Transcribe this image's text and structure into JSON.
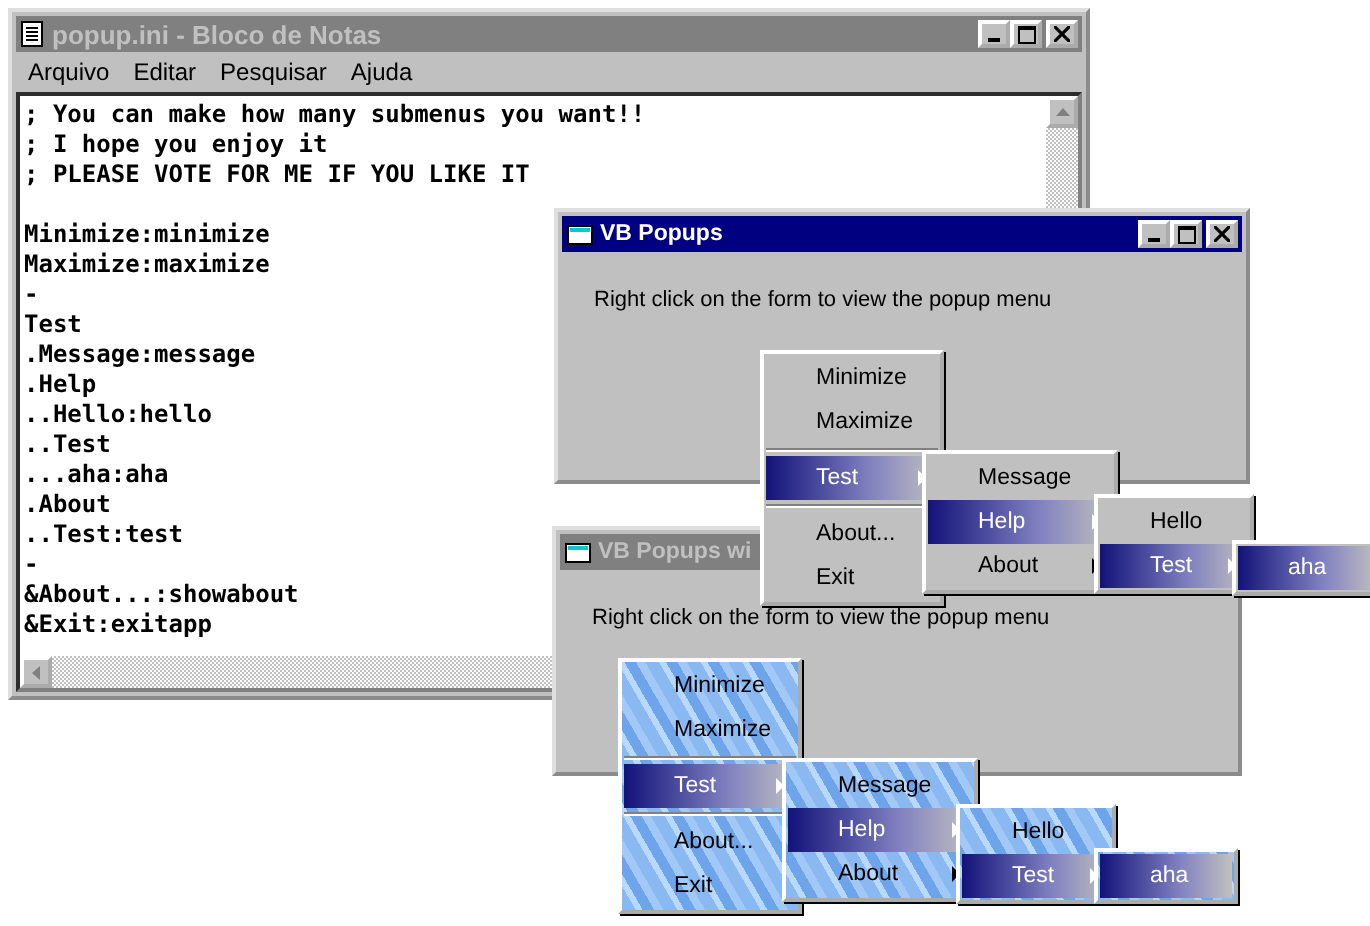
{
  "notepad": {
    "title": "popup.ini - Bloco de Notas",
    "active": false,
    "menu": [
      "Arquivo",
      "Editar",
      "Pesquisar",
      "Ajuda"
    ],
    "blocks": [
      [
        "; You can make how many submenus you want!!",
        "; I hope you enjoy it",
        "; PLEASE VOTE FOR ME IF YOU LIKE IT"
      ],
      [
        "Minimize:minimize",
        "Maximize:maximize",
        "-",
        "Test",
        ".Message:message",
        ".Help",
        "..Hello:hello",
        "..Test",
        "...aha:aha",
        ".About",
        "..Test:test",
        "-",
        "&About...:showabout",
        "&Exit:exitapp"
      ]
    ]
  },
  "windows": [
    {
      "title": "VB Popups",
      "active": true,
      "message": "Right click on the form to view the popup menu",
      "textured_menus": false,
      "menus": [
        [
          {
            "kind": "item",
            "label": "Minimize",
            "submenu": false,
            "selected": false
          },
          {
            "kind": "item",
            "label": "Maximize",
            "submenu": false,
            "selected": false
          },
          {
            "kind": "separator"
          },
          {
            "kind": "item",
            "label": "Test",
            "submenu": true,
            "selected": true
          },
          {
            "kind": "separator"
          },
          {
            "kind": "item",
            "label": "About...",
            "submenu": false,
            "selected": false
          },
          {
            "kind": "item",
            "label": "Exit",
            "submenu": false,
            "selected": false
          }
        ],
        [
          {
            "kind": "item",
            "label": "Message",
            "submenu": false,
            "selected": false
          },
          {
            "kind": "item",
            "label": "Help",
            "submenu": true,
            "selected": true
          },
          {
            "kind": "item",
            "label": "About",
            "submenu": true,
            "selected": false
          }
        ],
        [
          {
            "kind": "item",
            "label": "Hello",
            "submenu": false,
            "selected": false
          },
          {
            "kind": "item",
            "label": "Test",
            "submenu": true,
            "selected": true
          }
        ],
        [
          {
            "kind": "item",
            "label": "aha",
            "submenu": false,
            "selected": true
          }
        ]
      ]
    },
    {
      "title": "VB Popups wi",
      "active": false,
      "message": "Right click on the form to view the popup menu",
      "textured_menus": true,
      "menus": [
        [
          {
            "kind": "item",
            "label": "Minimize",
            "submenu": false,
            "selected": false
          },
          {
            "kind": "item",
            "label": "Maximize",
            "submenu": false,
            "selected": false
          },
          {
            "kind": "separator"
          },
          {
            "kind": "item",
            "label": "Test",
            "submenu": true,
            "selected": true
          },
          {
            "kind": "separator"
          },
          {
            "kind": "item",
            "label": "About...",
            "submenu": false,
            "selected": false
          },
          {
            "kind": "item",
            "label": "Exit",
            "submenu": false,
            "selected": false
          }
        ],
        [
          {
            "kind": "item",
            "label": "Message",
            "submenu": false,
            "selected": false
          },
          {
            "kind": "item",
            "label": "Help",
            "submenu": true,
            "selected": true
          },
          {
            "kind": "item",
            "label": "About",
            "submenu": true,
            "selected": false
          }
        ],
        [
          {
            "kind": "item",
            "label": "Hello",
            "submenu": false,
            "selected": false
          },
          {
            "kind": "item",
            "label": "Test",
            "submenu": true,
            "selected": true
          }
        ],
        [
          {
            "kind": "item",
            "label": "aha",
            "submenu": false,
            "selected": true
          }
        ]
      ]
    }
  ]
}
